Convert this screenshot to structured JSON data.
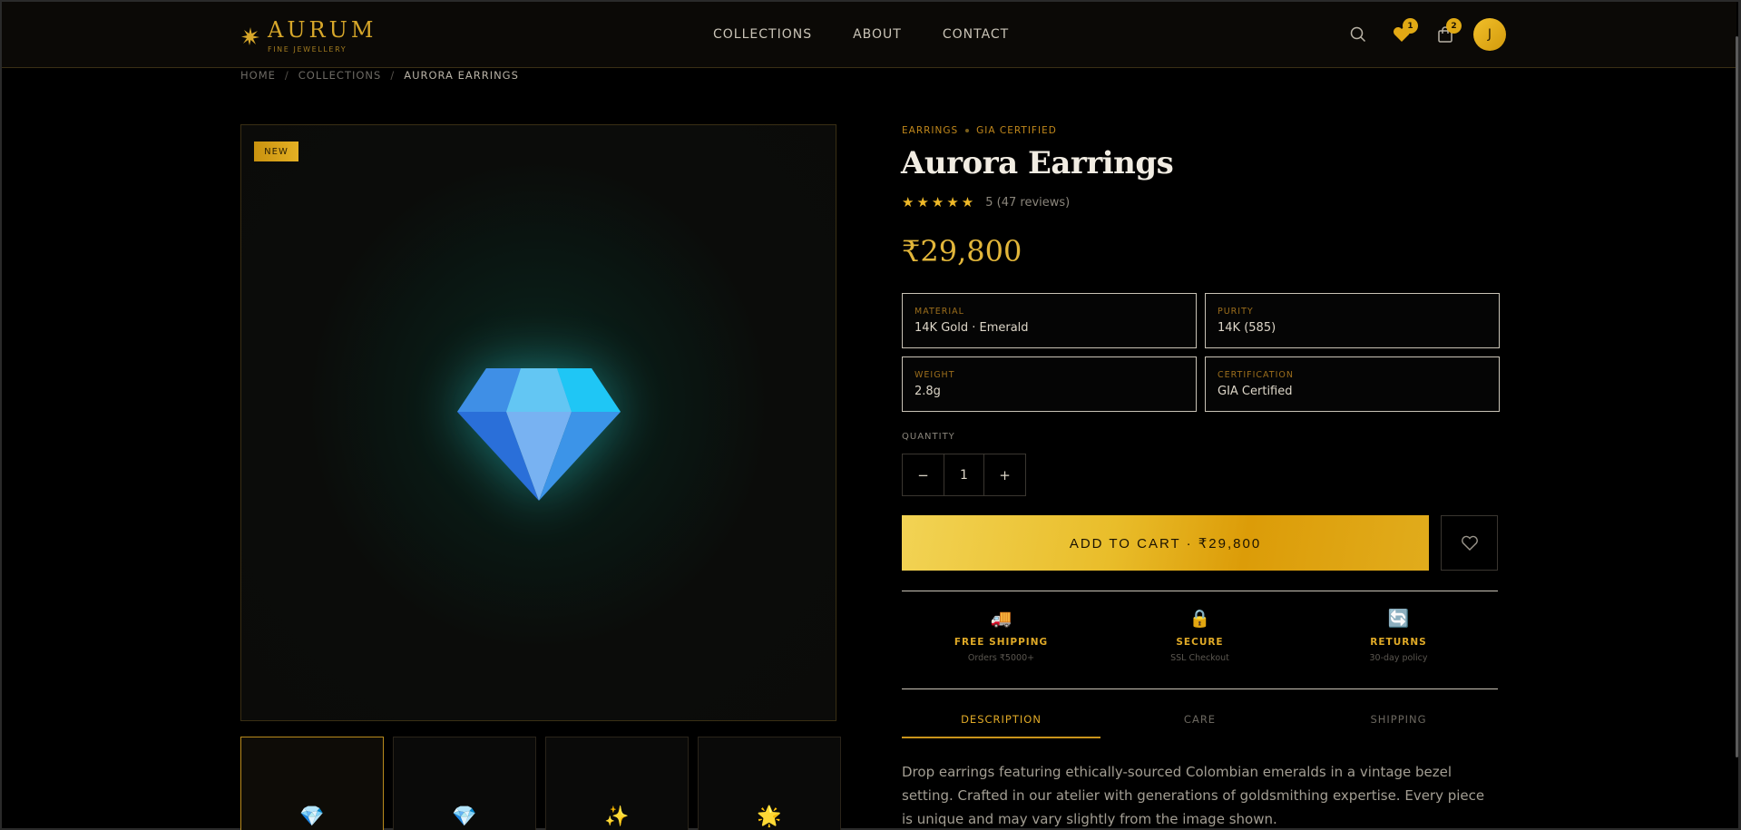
{
  "header": {
    "logo_name": "AURUM",
    "logo_sub": "FINE JEWELLERY",
    "nav": [
      "COLLECTIONS",
      "ABOUT",
      "CONTACT"
    ],
    "wishlist_count": "1",
    "cart_count": "2",
    "avatar_initial": "J"
  },
  "breadcrumb": [
    "HOME",
    "COLLECTIONS",
    "AURORA EARRINGS"
  ],
  "gallery": {
    "badge": "NEW",
    "thumbnails": [
      "💎",
      "💎",
      "✨",
      "🌟"
    ]
  },
  "product": {
    "category": "EARRINGS",
    "certified": "GIA CERTIFIED",
    "title": "Aurora Earrings",
    "stars": "★★★★★",
    "rating": "5",
    "reviews": "(47 reviews)",
    "price": "₹29,800",
    "specs": [
      {
        "label": "MATERIAL",
        "value": "14K Gold · Emerald"
      },
      {
        "label": "PURITY",
        "value": "14K (585)"
      },
      {
        "label": "WEIGHT",
        "value": "2.8g"
      },
      {
        "label": "CERTIFICATION",
        "value": "GIA Certified"
      }
    ],
    "quantity_label": "QUANTITY",
    "quantity": "1",
    "minus": "−",
    "plus": "+",
    "add_to_cart": "ADD TO CART · ₹29,800"
  },
  "features": [
    {
      "icon": "🚚",
      "title": "FREE SHIPPING",
      "sub": "Orders ₹5000+"
    },
    {
      "icon": "🔒",
      "title": "SECURE",
      "sub": "SSL Checkout"
    },
    {
      "icon": "🔄",
      "title": "RETURNS",
      "sub": "30-day policy"
    }
  ],
  "tabs": [
    "DESCRIPTION",
    "CARE",
    "SHIPPING"
  ],
  "description": "Drop earrings featuring ethically-sourced Colombian emeralds in a vintage bezel setting. Crafted in our atelier with generations of goldsmithing expertise. Every piece is unique and may vary slightly from the image shown.",
  "colors": {
    "gold": "#e0aa27",
    "background": "#000000",
    "gem": "#2aa8f0"
  }
}
